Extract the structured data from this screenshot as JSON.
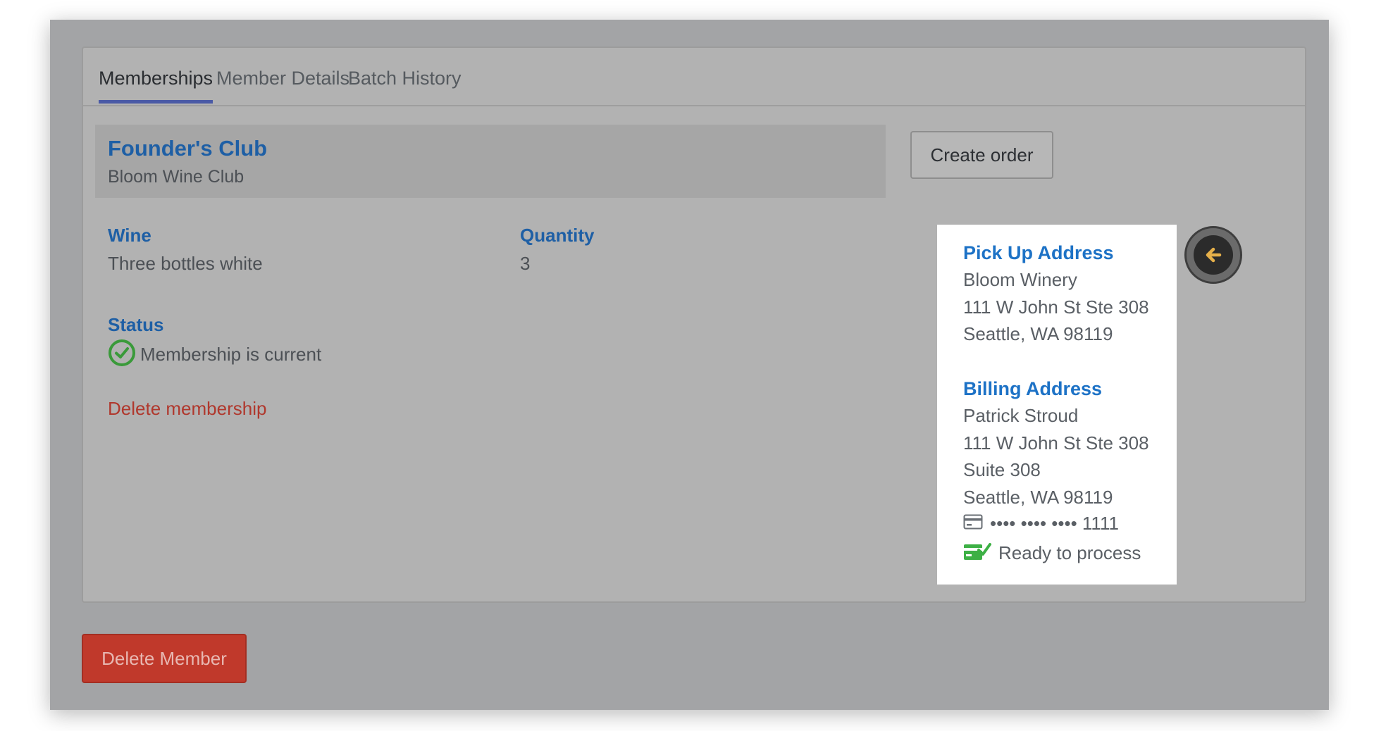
{
  "tabs": [
    {
      "label": "Memberships",
      "active": true
    },
    {
      "label": "Member Details",
      "active": false
    },
    {
      "label": "Batch History",
      "active": false
    }
  ],
  "membership": {
    "club_name": "Founder's Club",
    "club_org": "Bloom Wine Club",
    "wine_label": "Wine",
    "wine_value": "Three bottles white",
    "quantity_label": "Quantity",
    "quantity_value": "3",
    "status_label": "Status",
    "status_value": "Membership is current",
    "delete_label": "Delete membership"
  },
  "actions": {
    "create_order_label": "Create order",
    "delete_member_label": "Delete Member"
  },
  "address_card": {
    "pickup_title": "Pick Up Address",
    "pickup_lines": [
      "Bloom Winery",
      "111 W John St Ste 308",
      "Seattle, WA 98119"
    ],
    "billing_title": "Billing Address",
    "billing_lines": [
      "Patrick Stroud",
      "111 W John St Ste 308",
      "Suite 308",
      "Seattle, WA 98119"
    ],
    "card_masked": "•••• •••• •••• 1111",
    "payment_status": "Ready to process"
  },
  "icons": {
    "status": "check-circle-icon",
    "card": "credit-card-icon",
    "payment_ready": "card-check-icon",
    "back": "arrow-left-icon"
  },
  "colors": {
    "link_blue": "#1e5fa5",
    "card_title_blue": "#1d72c6",
    "tab_underline": "#4a5aa6",
    "danger": "#c0392b",
    "success_green": "#3a9a3a",
    "back_arrow": "#e6b04a"
  }
}
